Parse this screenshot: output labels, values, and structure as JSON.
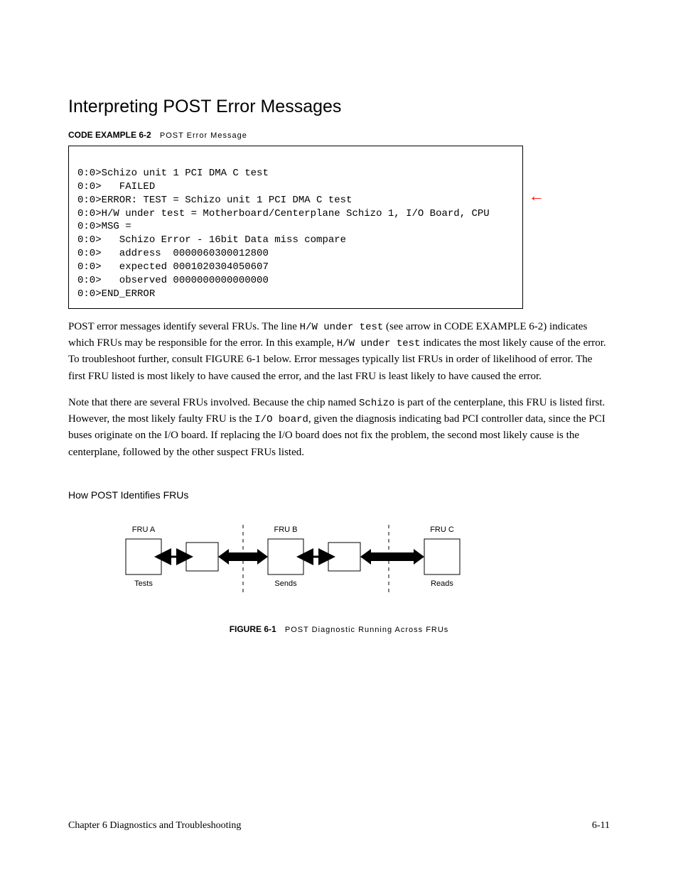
{
  "top_heading": "Interpreting POST Error Messages",
  "code_caption_label": "CODE EXAMPLE 6-2",
  "code_caption_text": "POST Error Message",
  "code_lines": {
    "l0": "0:0>Schizo unit 1 PCI DMA C test",
    "l1": "0:0>   FAILED",
    "l2": "0:0>ERROR: TEST = Schizo unit 1 PCI DMA C test",
    "l3": "0:0>H/W under test = Motherboard/Centerplane Schizo 1, I/O Board, CPU",
    "l4": "0:0>MSG =",
    "l5": "0:0>   Schizo Error - 16bit Data miss compare",
    "l6": "0:0>   address  0000060300012800",
    "l7": "0:0>   expected 0001020304050607",
    "l8": "0:0>   observed 0000000000000000",
    "l9": "0:0>END_ERROR"
  },
  "para1": {
    "pre": "POST error messages identify several FRUs. The line ",
    "code1": "H/W under test",
    "mid": " (see arrow in CODE EXAMPLE 6-2) indicates which FRUs may be responsible for the error. In this example, ",
    "code2": "H/W under test",
    "post": " indicates the most likely cause of the error. To troubleshoot further, consult FIGURE 6-1 below. Error messages typically list FRUs in order of likelihood of error. The first FRU listed is most likely to have caused the error, and the last FRU is least likely to have caused the error."
  },
  "para2": {
    "pre": "Note that there are several FRUs involved. Because the chip named ",
    "code1": "Schizo",
    "mid": " is part of the centerplane, this FRU is listed first. However, the most likely faulty FRU is the ",
    "code2": "I/O board",
    "post": ", given the diagnosis indicating bad PCI controller data, since the PCI buses originate on the I/O board. If replacing the I/O board does not fix the problem, the second most likely cause is the centerplane, followed by the other suspect FRUs listed."
  },
  "subheading": "How POST Identifies FRUs",
  "fig_caption_label": "FIGURE 6-1",
  "fig_caption_text": "POST Diagnostic Running Across FRUs",
  "diagram_labels": {
    "fru_a": "FRU A",
    "fru_b": "FRU B",
    "fru_c": "FRU C",
    "tests": "Tests",
    "sends": "Sends",
    "reads": "Reads"
  },
  "footer_left": "Chapter 6    Diagnostics and Troubleshooting",
  "footer_right": "6-11"
}
